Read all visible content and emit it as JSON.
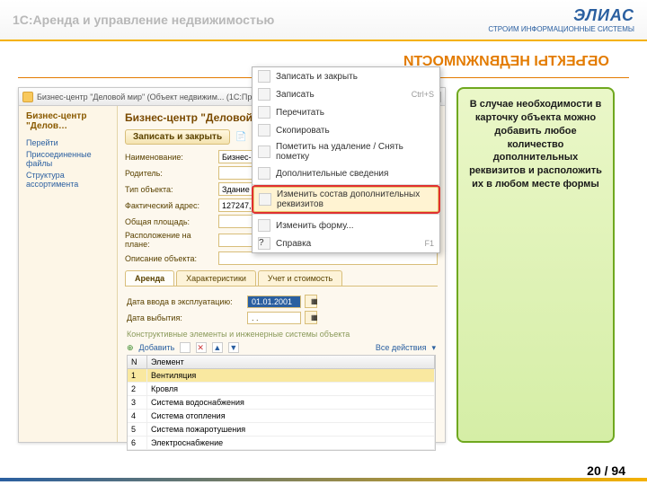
{
  "top": {
    "title": "1С:Аренда и управление недвижимостью",
    "logo_big": "ЭЛИАС",
    "logo_sub": "СТРОИМ ИНФОРМАЦИОННЫЕ СИСТЕМЫ"
  },
  "section_title": "ОБЪЕКТЫ НЕДВИЖИМОСТИ",
  "window": {
    "title": "Бизнес-центр \"Деловой мир\" (Объект недвижим...   (1С:Предприятие)",
    "sidepanel": {
      "head": "Бизнес-центр \"Делов…",
      "links": [
        "Перейти",
        "Присоединенные файлы",
        "Структура ассортимента"
      ]
    },
    "object_title": "Бизнес-центр \"Деловой мир\" (Объект недвижимости)",
    "toolbar": {
      "save_close": "Записать и закрыть",
      "all_actions": "Все действия"
    },
    "form": {
      "name_label": "Наименование:",
      "name_value": "Бизнес-центр \"Деловой мир\"",
      "parent_label": "Родитель:",
      "parent_value": "",
      "type_label": "Тип объекта:",
      "type_value": "Здание",
      "addr_label": "Фактический адрес:",
      "addr_value": "127247, Москва г, Д",
      "area_label": "Общая площадь:",
      "area_value": "15 500,00",
      "plan_label": "Расположение на плане:",
      "desc_label": "Описание объекта:"
    },
    "tabs": [
      "Аренда",
      "Характеристики",
      "Учет и стоимость"
    ],
    "dates": {
      "enter_label": "Дата ввода в эксплуатацию:",
      "enter_value": "01.01.2001",
      "exit_label": "Дата выбытия:",
      "exit_value": ". ."
    },
    "fieldset": "Конструктивные элементы и инженерные системы объекта",
    "tbl_toolbar": {
      "add": "Добавить",
      "all_actions": "Все действия"
    },
    "grid": {
      "headers": [
        "N",
        "Элемент"
      ],
      "rows": [
        {
          "n": "1",
          "el": "Вентиляция"
        },
        {
          "n": "2",
          "el": "Кровля"
        },
        {
          "n": "3",
          "el": "Система водоснабжения"
        },
        {
          "n": "4",
          "el": "Система отопления"
        },
        {
          "n": "5",
          "el": "Система пожаротушения"
        },
        {
          "n": "6",
          "el": "Электроснабжение"
        }
      ]
    }
  },
  "context_menu": [
    {
      "label": "Записать и закрыть",
      "key": ""
    },
    {
      "label": "Записать",
      "key": "Ctrl+S"
    },
    {
      "label": "Перечитать",
      "key": ""
    },
    {
      "label": "Скопировать",
      "key": ""
    },
    {
      "label": "Пометить на удаление / Снять пометку",
      "key": ""
    },
    {
      "label": "Дополнительные сведения",
      "key": ""
    },
    {
      "label": "Изменить состав дополнительных реквизитов",
      "key": "",
      "highlight": true
    },
    {
      "label": "Изменить форму...",
      "key": ""
    },
    {
      "label": "Справка",
      "key": "F1"
    }
  ],
  "callout": "В случае необходимости в карточку объекта можно добавить любое количество дополнительных реквизитов и расположить их в любом месте формы",
  "page": "20 / 94"
}
